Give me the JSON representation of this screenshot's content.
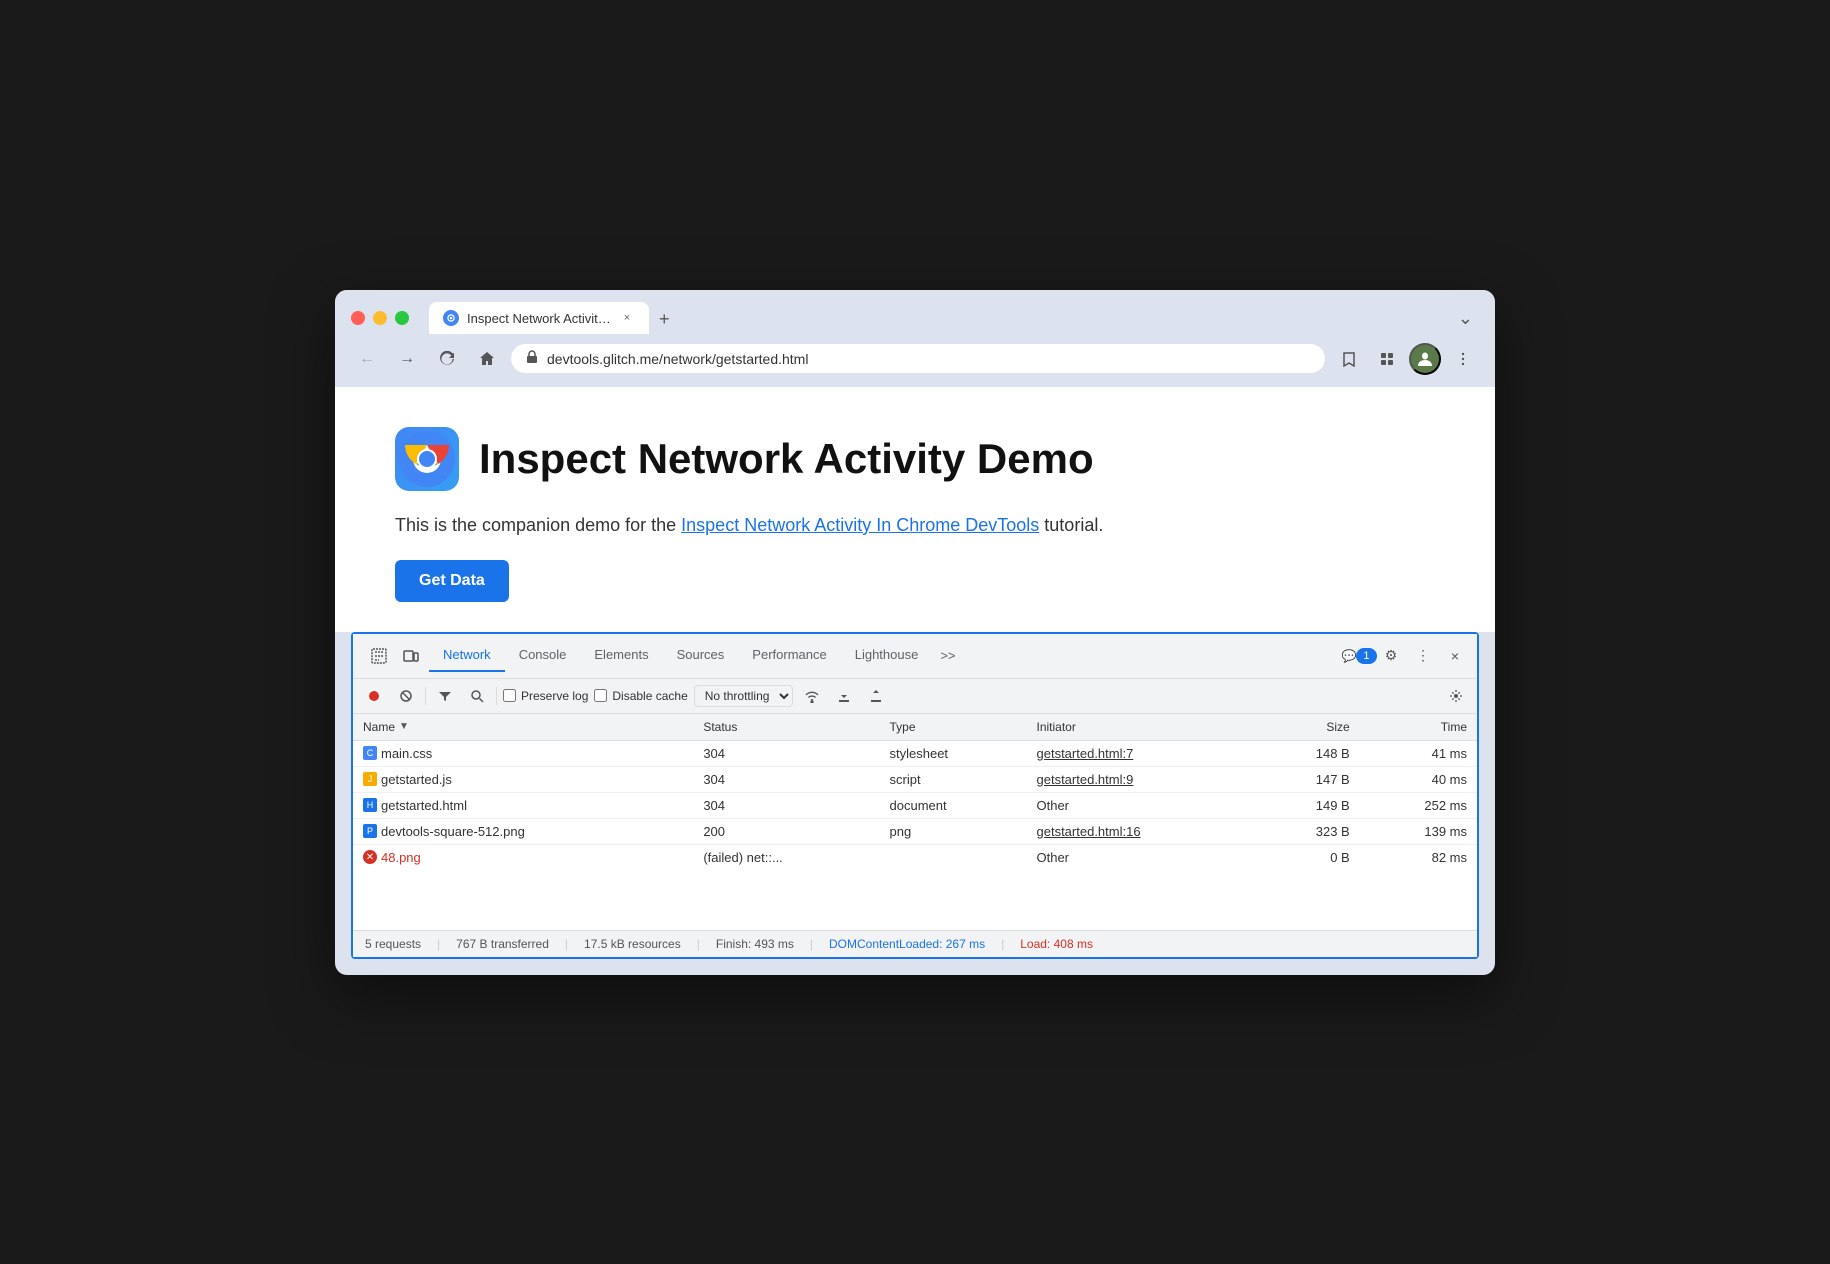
{
  "browser": {
    "tab_title": "Inspect Network Activity Dem",
    "tab_close": "×",
    "tab_new": "+",
    "tab_dropdown": "⌄",
    "url": "devtools.glitch.me/network/getstarted.html",
    "nav_back": "←",
    "nav_forward": "→",
    "nav_reload": "↺",
    "nav_home": "⌂"
  },
  "page": {
    "title": "Inspect Network Activity Demo",
    "subtitle_prefix": "This is the companion demo for the ",
    "subtitle_link": "Inspect Network Activity In Chrome DevTools",
    "subtitle_suffix": " tutorial.",
    "get_data_label": "Get Data"
  },
  "devtools": {
    "tabs": [
      "Network",
      "Console",
      "Elements",
      "Sources",
      "Performance",
      "Lighthouse"
    ],
    "tab_more": ">>",
    "active_tab": "Network",
    "badge_label": "1",
    "toolbar_icons": [
      "record-stop",
      "clear",
      "filter",
      "search"
    ],
    "preserve_log_label": "Preserve log",
    "disable_cache_label": "Disable cache",
    "throttle_label": "No throttling",
    "close": "×",
    "settings": "⚙",
    "more": "⋮"
  },
  "network_table": {
    "columns": [
      "Name",
      "Status",
      "Type",
      "Initiator",
      "Size",
      "Time"
    ],
    "rows": [
      {
        "icon_type": "css",
        "icon_label": "C",
        "name": "main.css",
        "status": "304",
        "type": "stylesheet",
        "initiator": "getstarted.html:7",
        "initiator_link": true,
        "size": "148 B",
        "time": "41 ms",
        "failed": false
      },
      {
        "icon_type": "js",
        "icon_label": "J",
        "name": "getstarted.js",
        "status": "304",
        "type": "script",
        "initiator": "getstarted.html:9",
        "initiator_link": true,
        "size": "147 B",
        "time": "40 ms",
        "failed": false
      },
      {
        "icon_type": "html",
        "icon_label": "H",
        "name": "getstarted.html",
        "status": "304",
        "type": "document",
        "initiator": "Other",
        "initiator_link": false,
        "size": "149 B",
        "time": "252 ms",
        "failed": false
      },
      {
        "icon_type": "png",
        "icon_label": "P",
        "name": "devtools-square-512.png",
        "status": "200",
        "type": "png",
        "initiator": "getstarted.html:16",
        "initiator_link": true,
        "size": "323 B",
        "time": "139 ms",
        "failed": false
      },
      {
        "icon_type": "err",
        "icon_label": "✕",
        "name": "48.png",
        "status": "(failed)  net::...",
        "type": "",
        "initiator": "Other",
        "initiator_link": false,
        "size": "0 B",
        "time": "82 ms",
        "failed": true
      }
    ]
  },
  "status_bar": {
    "requests": "5 requests",
    "transferred": "767 B transferred",
    "resources": "17.5 kB resources",
    "finish": "Finish: 493 ms",
    "dom_content_loaded": "DOMContentLoaded: 267 ms",
    "load": "Load: 408 ms"
  }
}
